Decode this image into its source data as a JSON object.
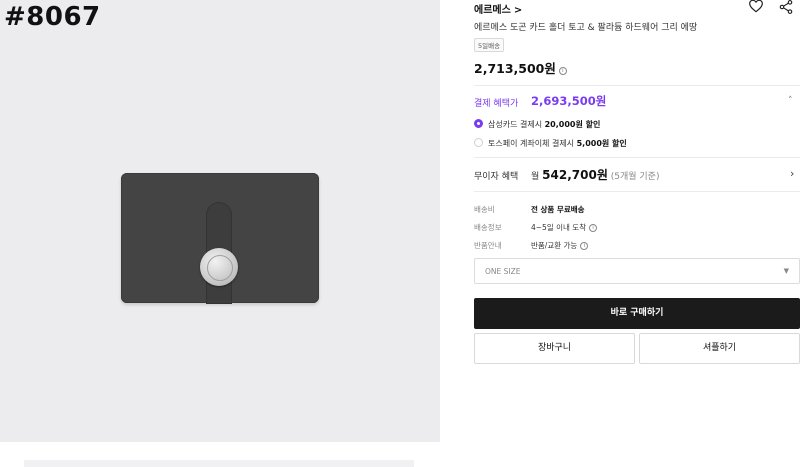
{
  "image_panel": {
    "product_code": "#8067"
  },
  "product": {
    "brand": "에르메스",
    "brand_chevron": ">",
    "name": "에르메스 도곤 카드 홀더 토고 & 팔라듐 하드웨어 그리 에땅",
    "shipping_badge": "5일배송",
    "price": "2,713,500원",
    "price_info_icon": "i"
  },
  "benefit": {
    "label": "결제 혜택가",
    "price": "2,693,500원",
    "collapse_icon": "˄",
    "options": [
      {
        "prefix": "삼성카드 결제시 ",
        "amount": "20,000원 할인",
        "selected": true
      },
      {
        "prefix": "토스페이 계좌이체 결제시 ",
        "amount": "5,000원 할인",
        "selected": false
      }
    ]
  },
  "installment": {
    "label": "무이자 혜택",
    "prefix": "월 ",
    "amount": "542,700원",
    "note": "(5개월 기준)",
    "chevron": "›"
  },
  "details": [
    {
      "key": "배송비",
      "value": "전 상품 무료배송",
      "info": ""
    },
    {
      "key": "배송정보",
      "value": "4~5일 이내 도착",
      "info": "i"
    },
    {
      "key": "반품안내",
      "value": "반품/교환 가능",
      "info": "i"
    }
  ],
  "size_select": {
    "value": "ONE SIZE",
    "caret": "▼"
  },
  "actions": {
    "buy_label": "바로 구매하기",
    "cart_label": "장바구니",
    "shop_label": "셔플하기"
  },
  "colors": {
    "accent": "#7a3cf0",
    "buy_button": "#1b1b1b",
    "image_bg": "#ececef",
    "wallet": "#444444"
  },
  "icons": {
    "wishlist": "heart-icon",
    "share": "share-icon"
  }
}
